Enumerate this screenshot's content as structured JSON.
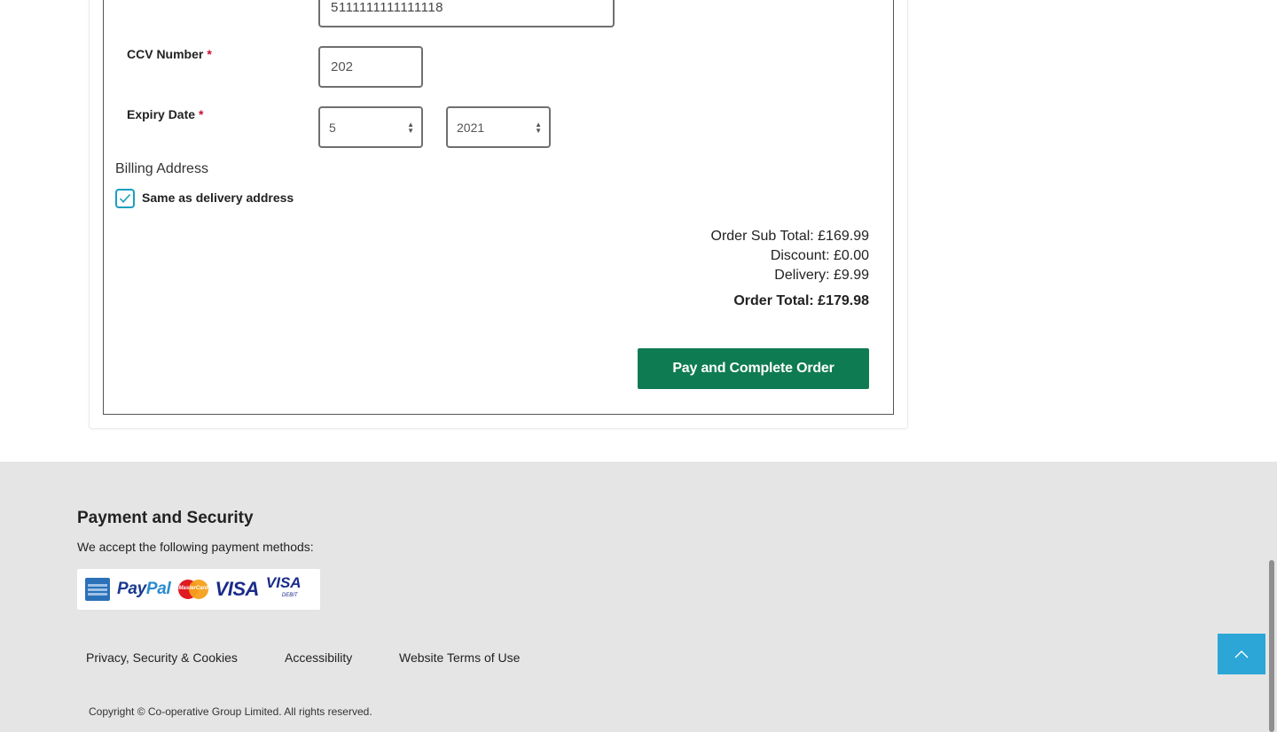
{
  "payment_form": {
    "card_number_value": "5111111111111118",
    "ccv_label": "CCV Number",
    "ccv_value": "202",
    "expiry_label": "Expiry Date",
    "expiry_month": "5",
    "expiry_year": "2021",
    "required_mark": "*"
  },
  "billing": {
    "title": "Billing Address",
    "same_as_delivery_label": "Same as delivery address",
    "same_as_delivery_checked": true
  },
  "summary": {
    "subtotal": "Order Sub Total: £169.99",
    "discount": "Discount: £0.00",
    "delivery": "Delivery: £9.99",
    "total": "Order Total: £179.98"
  },
  "pay_button_label": "Pay and Complete Order",
  "footer": {
    "title": "Payment and Security",
    "accept_text": "We accept the following payment methods:",
    "payment_methods": [
      "American Express",
      "PayPal",
      "MasterCard",
      "VISA",
      "VISA Debit"
    ],
    "links": [
      "Privacy, Security & Cookies",
      "Accessibility",
      "Website Terms of Use"
    ],
    "copyright": "Copyright © Co-operative Group Limited. All rights reserved."
  },
  "colors": {
    "pay_button": "#0f7b52",
    "checkbox_accent": "#1a9fbf",
    "required": "#c8102e",
    "back_to_top": "#2ba6d7",
    "footer_bg": "#e5e5e5"
  },
  "icons": {
    "back_to_top": "chevron-up-icon",
    "checkbox": "checkmark-icon"
  }
}
